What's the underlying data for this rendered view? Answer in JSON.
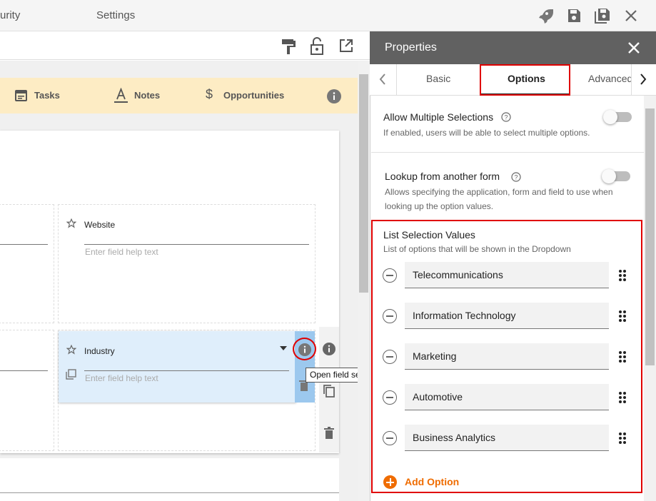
{
  "topbar": {
    "tabs": [
      "urity",
      "Settings"
    ],
    "icons": [
      "rocket-icon",
      "save-icon",
      "save-as-icon",
      "close-icon"
    ]
  },
  "designer": {
    "toolbar_icons": [
      "format-paint-icon",
      "lock-open-icon",
      "open-external-icon"
    ],
    "tabs": [
      {
        "label": "Tasks",
        "icon": "calendar-icon"
      },
      {
        "label": "Notes",
        "icon": "text-a-icon"
      },
      {
        "label": "Opportunities",
        "icon": "dollar-icon"
      }
    ],
    "fields": [
      {
        "label": "Website",
        "help_placeholder": "Enter field help text"
      },
      {
        "label": "Industry",
        "help_placeholder": "Enter field help text"
      }
    ],
    "tooltip": "Open field settings"
  },
  "props": {
    "title": "Properties",
    "tabs": [
      "Basic",
      "Options",
      "Advanced"
    ],
    "active_tab": "Options",
    "allow_multiple": {
      "title": "Allow Multiple Selections",
      "desc": "If enabled, users will be able to select multiple options.",
      "enabled": false
    },
    "lookup": {
      "title": "Lookup from another form",
      "desc": "Allows specifying the application, form and field to use when looking up the option values.",
      "enabled": false
    },
    "list": {
      "title": "List Selection Values",
      "desc": "List of options that will be shown in the Dropdown",
      "options": [
        "Telecommunications",
        "Information Technology",
        "Marketing",
        "Automotive",
        "Business Analytics"
      ],
      "add_label": "Add Option"
    }
  },
  "colors": {
    "highlight": "#e00000",
    "accent": "#ef6c00",
    "tabstrip": "#fdecc4",
    "selected_field": "#dfeefb",
    "header": "#616161"
  }
}
